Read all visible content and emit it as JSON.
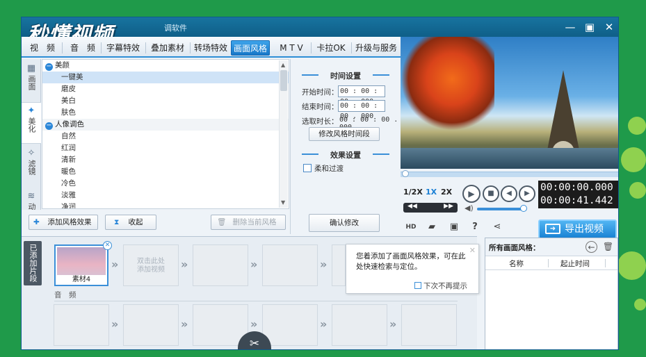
{
  "app": {
    "logo_text": "秒懂视频",
    "title_text": "调软件",
    "colors": {
      "accent": "#2c8ed6",
      "title_bar": "#0f5f88",
      "export": "#1a83d4",
      "background": "#1f9a4a"
    }
  },
  "tabs": [
    {
      "label": "视　频"
    },
    {
      "label": "音　频"
    },
    {
      "label": "字幕特效"
    },
    {
      "label": "叠加素材"
    },
    {
      "label": "转场特效"
    },
    {
      "label": "画面风格"
    },
    {
      "label": "M T V"
    },
    {
      "label": "卡拉OK"
    },
    {
      "label": "升级与服务"
    }
  ],
  "side_tabs": [
    {
      "label": "画面",
      "icon": "film-icon"
    },
    {
      "label": "美化",
      "icon": "magic-wand-icon"
    },
    {
      "label": "滤镜",
      "icon": "filter-icon"
    },
    {
      "label": "动景",
      "icon": "wave-icon"
    }
  ],
  "effect_list": {
    "categories": [
      {
        "name": "美颜",
        "items": [
          "一键美",
          "磨皮",
          "美白",
          "肤色"
        ]
      },
      {
        "name": "人像调色",
        "items": [
          "自然",
          "红润",
          "清新",
          "暖色",
          "冷色",
          "淡雅",
          "净润"
        ]
      }
    ],
    "selected_item": "一键美"
  },
  "list_actions": {
    "add": "添加风格效果",
    "collapse": "收起",
    "delete": "删除当前风格"
  },
  "time_settings": {
    "header": "时间设置",
    "start_label": "开始时间：",
    "start_value": "00 : 00 : 00 . 000",
    "end_label": "结束时间：",
    "end_value": "00 : 00 : 00 . 000",
    "duration_label": "选取时长：",
    "duration_value": "00 : 00 : 00 . 000",
    "modify_button": "修改风格时间段",
    "effect_header": "效果设置",
    "soft_transition": "柔和过渡",
    "confirm_button": "确认修改"
  },
  "player": {
    "speeds": [
      "1/2X",
      "1X",
      "2X"
    ],
    "active_speed": "1X",
    "current_time": "00:00:00.000",
    "total_time": "00:00:41.442",
    "export_label": "导出视频"
  },
  "timeline": {
    "clip_section_label": "已添加片段",
    "clip_name": "素材4",
    "add_hint_line1": "双击此处",
    "add_hint_line2": "添加视频",
    "audio_label": "音　频"
  },
  "tooltip": {
    "message": "您着添加了画面风格效果，可在此处快速检索与定位。",
    "dont_show": "下次不再提示"
  },
  "right_panel": {
    "title": "所有画面风格：",
    "col_name": "名称",
    "col_time": "起止时间"
  }
}
